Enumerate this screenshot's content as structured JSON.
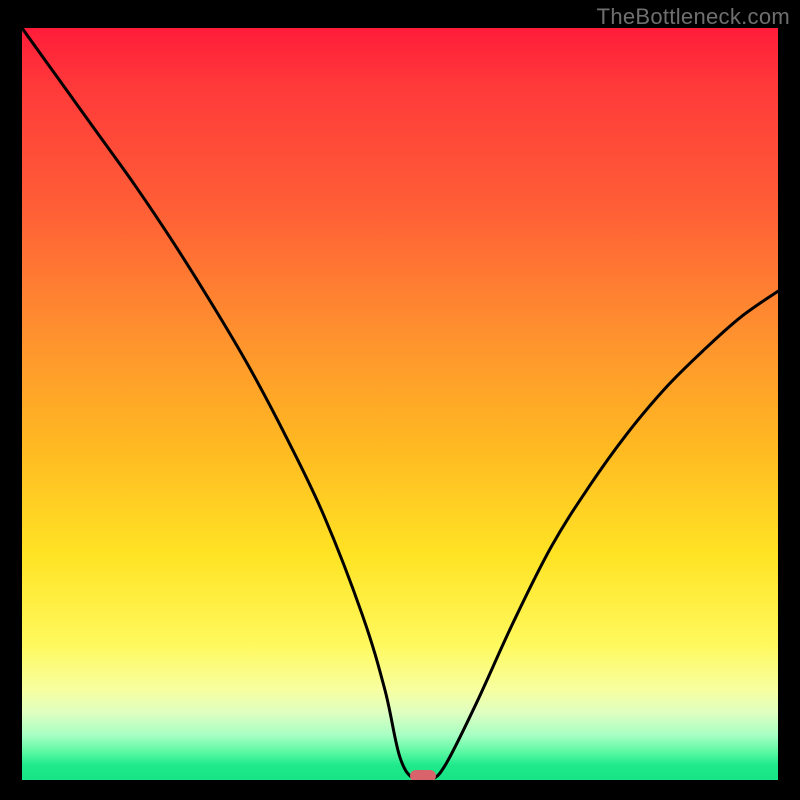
{
  "watermark": "TheBottleneck.com",
  "chart_data": {
    "type": "line",
    "title": "",
    "xlabel": "",
    "ylabel": "",
    "xlim": [
      0,
      100
    ],
    "ylim": [
      0,
      100
    ],
    "grid": false,
    "x": [
      0,
      5,
      10,
      15,
      20,
      25,
      30,
      35,
      40,
      45,
      48,
      50,
      52,
      54,
      56,
      60,
      65,
      70,
      75,
      80,
      85,
      90,
      95,
      100
    ],
    "values": [
      100,
      93,
      86,
      79,
      71.5,
      63.5,
      55,
      45.5,
      35,
      22,
      12,
      3,
      0,
      0,
      2,
      10,
      21,
      31,
      39,
      46,
      52,
      57,
      61.5,
      65
    ],
    "minimum_marker": {
      "x": 53,
      "y": 0
    },
    "background_gradient": {
      "top": "#ff1c3a",
      "middle": "#ffe324",
      "bottom": "#17e486"
    }
  }
}
